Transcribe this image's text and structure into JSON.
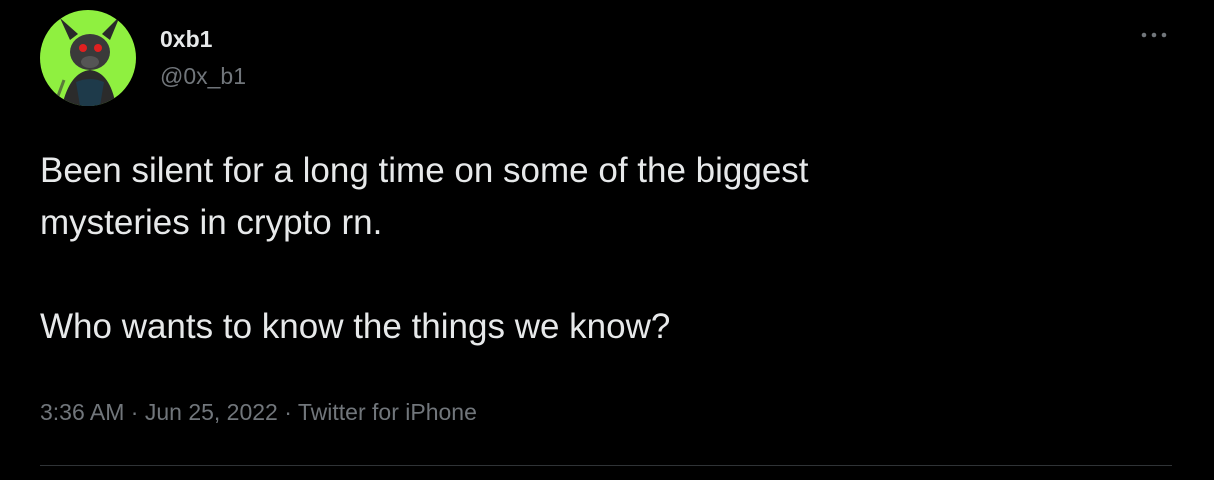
{
  "author": {
    "display_name": "0xb1",
    "handle": "@0x_b1"
  },
  "avatar": {
    "icon": "avatar-image",
    "background": "#8ff040"
  },
  "more_icon": "more-options-icon",
  "tweet": {
    "paragraph_1": "Been silent for a long time on some of the biggest\nmysteries in crypto rn.",
    "paragraph_2": "Who wants to know the things we know?"
  },
  "meta": {
    "time": "3:36 AM",
    "separator": " · ",
    "date": "Jun 25, 2022",
    "source": "Twitter for iPhone"
  },
  "colors": {
    "background": "#000000",
    "text_primary": "#e7e9ea",
    "text_secondary": "#71767b",
    "divider": "#2f3336"
  }
}
